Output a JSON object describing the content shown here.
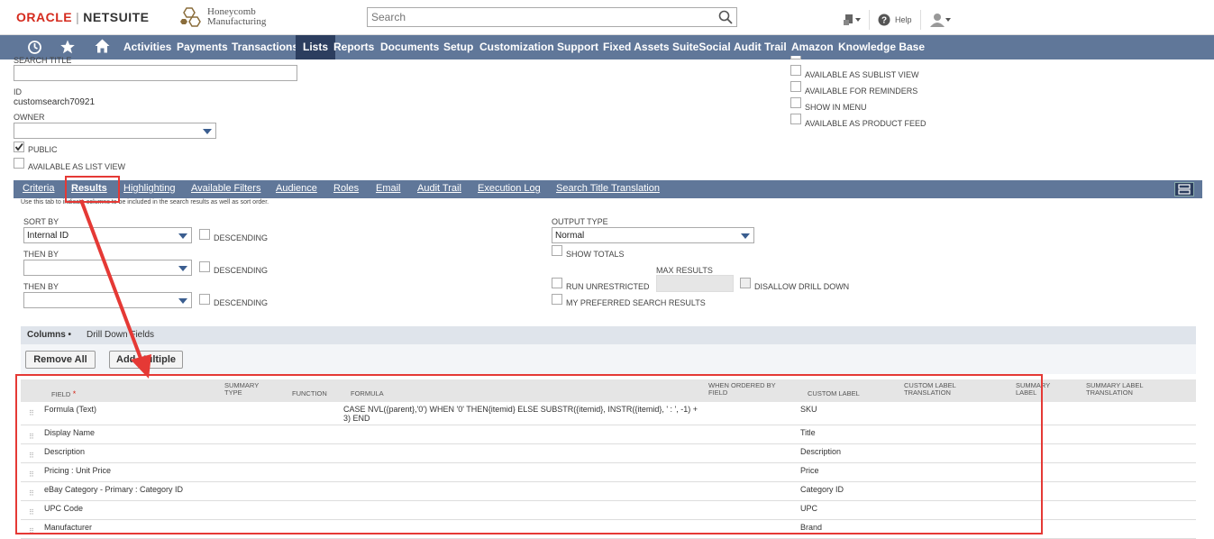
{
  "header": {
    "brand_oracle": "ORACLE",
    "brand_sep": "|",
    "brand_netsuite": "NETSUITE",
    "company_line1": "Honeycomb",
    "company_line2": "Manufacturing",
    "search_placeholder": "Search",
    "help_label": "Help"
  },
  "nav": {
    "items": [
      "Activities",
      "Payments",
      "Transactions",
      "Lists",
      "Reports",
      "Documents",
      "Setup",
      "Customization",
      "Support",
      "Fixed Assets",
      "SuiteSocial",
      "Audit Trail",
      "Amazon",
      "Knowledge Base"
    ],
    "active": "Lists"
  },
  "form": {
    "search_title_label": "SEARCH TITLE",
    "id_label": "ID",
    "id_value": "customsearch70921",
    "owner_label": "OWNER",
    "public_label": "PUBLIC",
    "available_list_view_label": "AVAILABLE AS LIST VIEW",
    "right_checks": [
      "AVAILABLE AS SUBLIST VIEW",
      "AVAILABLE FOR REMINDERS",
      "SHOW IN MENU",
      "AVAILABLE AS PRODUCT FEED"
    ]
  },
  "subtabs": {
    "items": [
      "Criteria",
      "Results",
      "Highlighting",
      "Available Filters",
      "Audience",
      "Roles",
      "Email",
      "Audit Trail",
      "Execution Log",
      "Search Title Translation"
    ],
    "active": "Results",
    "help_text": "Use this tab to indicate columns to be included in the search results as well as sort order."
  },
  "results": {
    "sort_by_label": "SORT BY",
    "sort_by_value": "Internal ID",
    "then_by_label": "THEN BY",
    "descending_label": "DESCENDING",
    "output_type_label": "OUTPUT TYPE",
    "output_type_value": "Normal",
    "show_totals_label": "SHOW TOTALS",
    "max_results_label": "MAX RESULTS",
    "run_unrestricted_label": "RUN UNRESTRICTED",
    "disallow_drill_down_label": "DISALLOW DRILL DOWN",
    "preferred_results_label": "MY PREFERRED SEARCH RESULTS"
  },
  "columns": {
    "tab_columns": "Columns",
    "tab_drilldown": "Drill Down Fields",
    "remove_all": "Remove All",
    "add_multiple": "Add Multiple",
    "headers": {
      "field": "FIELD",
      "summary_type_1": "SUMMARY",
      "summary_type_2": "TYPE",
      "function": "FUNCTION",
      "formula": "FORMULA",
      "when_ordered_1": "WHEN ORDERED BY",
      "when_ordered_2": "FIELD",
      "custom_label": "CUSTOM LABEL",
      "custom_label_tr_1": "CUSTOM LABEL",
      "custom_label_tr_2": "TRANSLATION",
      "summary_label_1": "SUMMARY",
      "summary_label_2": "LABEL",
      "summary_label_tr_1": "SUMMARY LABEL",
      "summary_label_tr_2": "TRANSLATION"
    },
    "rows": [
      {
        "field": "Formula (Text)",
        "formula": "CASE NVL({parent},'0') WHEN '0' THEN{itemid} ELSE SUBSTR({itemid}, INSTR({itemid}, ' : ', -1) + 3) END",
        "label": "SKU"
      },
      {
        "field": "Display Name",
        "formula": "",
        "label": "Title"
      },
      {
        "field": "Description",
        "formula": "",
        "label": "Description"
      },
      {
        "field": "Pricing : Unit Price",
        "formula": "",
        "label": "Price"
      },
      {
        "field": "eBay Category - Primary : Category ID",
        "formula": "",
        "label": "Category ID"
      },
      {
        "field": "UPC Code",
        "formula": "",
        "label": "UPC"
      },
      {
        "field": "Manufacturer",
        "formula": "",
        "label": "Brand"
      }
    ]
  },
  "colors": {
    "nav_bg": "#607799",
    "nav_active": "#2c3e5f",
    "annotation_red": "#e53935",
    "oracle_red": "#d52b1e"
  }
}
